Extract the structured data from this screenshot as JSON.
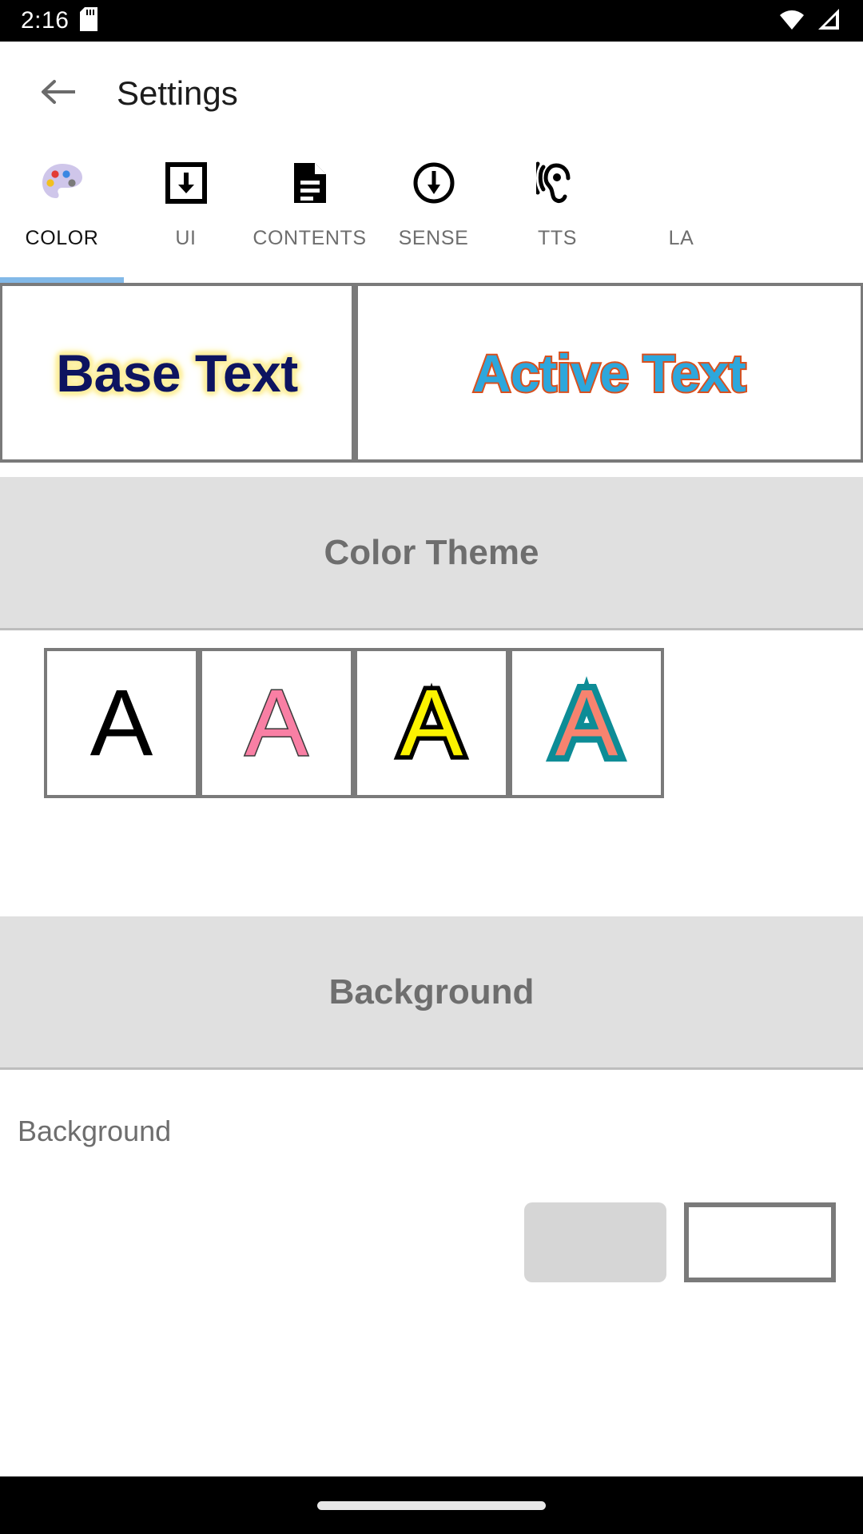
{
  "status_bar": {
    "clock": "2:16",
    "left_icons": [
      "sd-card-icon"
    ],
    "right_icons": [
      "wifi-icon",
      "cellular-signal-icon"
    ],
    "background_color": "#000000"
  },
  "app_bar": {
    "back_icon": "arrow-left-icon",
    "title": "Settings"
  },
  "tabs": {
    "active_index": 0,
    "indicator_color": "#82b9e8",
    "items": [
      {
        "label": "COLOR",
        "icon": "palette-icon"
      },
      {
        "label": "UI",
        "icon": "download-box-icon"
      },
      {
        "label": "CONTENTS",
        "icon": "document-icon"
      },
      {
        "label": "SENSE",
        "icon": "circle-down-arrow-icon"
      },
      {
        "label": "TTS",
        "icon": "ear-hearing-icon"
      },
      {
        "label": "LA",
        "icon": "language-icon"
      }
    ]
  },
  "preview": {
    "base": {
      "text": "Base Text",
      "text_color": "#0d1460",
      "glow_color": "#fdf0a0"
    },
    "active": {
      "text": "Active Text",
      "text_color": "#2da7dc",
      "outline_color": "#d9501e"
    },
    "frame_color": "#7a7a7a"
  },
  "color_theme_section": {
    "header": "Color Theme",
    "header_bg": "#e0e0e0",
    "header_text_color": "#6e6e6e",
    "swatches": [
      {
        "letter": "A",
        "fill": "#000000",
        "stroke": "#000000",
        "stroke_width": 0,
        "name": "theme-black"
      },
      {
        "letter": "A",
        "fill": "#f97fa4",
        "stroke": "#3a3a3a",
        "stroke_width": 3,
        "name": "theme-pink"
      },
      {
        "letter": "A",
        "fill": "#fcf300",
        "stroke": "#000000",
        "stroke_width": 11,
        "name": "theme-yellow"
      },
      {
        "letter": "A",
        "fill": "#f7836f",
        "stroke": "#0d8c96",
        "stroke_width": 16,
        "name": "theme-coral-teal"
      }
    ]
  },
  "background_section": {
    "header": "Background",
    "header_bg": "#e0e0e0",
    "header_text_color": "#6e6e6e",
    "row_label": "Background",
    "button_color": "#d6d6d6",
    "swatch_color": "#ffffff",
    "swatch_border": "#7a7a7a"
  },
  "nav_bar": {
    "home_indicator": "home-indicator-pill",
    "background_color": "#000000"
  }
}
